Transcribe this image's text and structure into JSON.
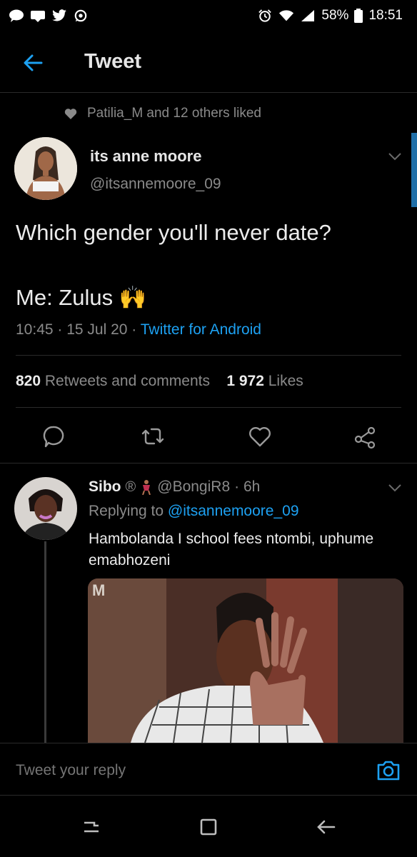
{
  "status_bar": {
    "battery": "58%",
    "time": "18:51",
    "left_icons": [
      "chat-bubble-icon",
      "message-icon",
      "twitter-icon",
      "whatsapp-icon"
    ],
    "right_icons": [
      "alarm-icon",
      "wifi-icon",
      "signal-icon",
      "battery-icon"
    ]
  },
  "header": {
    "title": "Tweet"
  },
  "liked": {
    "text": "Patilia_M and 12 others liked"
  },
  "tweet": {
    "author_name": "its anne moore",
    "author_handle": "@itsannemoore_09",
    "line1": "Which gender you'll never date?",
    "line2": "Me: Zulus",
    "emoji": "🙌",
    "time": "10:45 · 15 Jul 20 · ",
    "client": "Twitter for Android",
    "retweets_count": "820",
    "retweets_label": " Retweets and comments",
    "likes_count": "1 972",
    "likes_label": " Likes"
  },
  "reply": {
    "name": "Sibo",
    "badge": "®",
    "handle": "@BongiR8",
    "time": "· 6h",
    "replying_prefix": "Replying to ",
    "replying_to": "@itsannemoore_09",
    "text": "Hambolanda I school fees ntombi, uphume emabhozeni",
    "media_overlay": "M"
  },
  "reply_bar": {
    "placeholder": "Tweet your reply"
  },
  "colors": {
    "accent": "#1da1f2",
    "background": "#000000",
    "muted": "#8a8a8a"
  }
}
